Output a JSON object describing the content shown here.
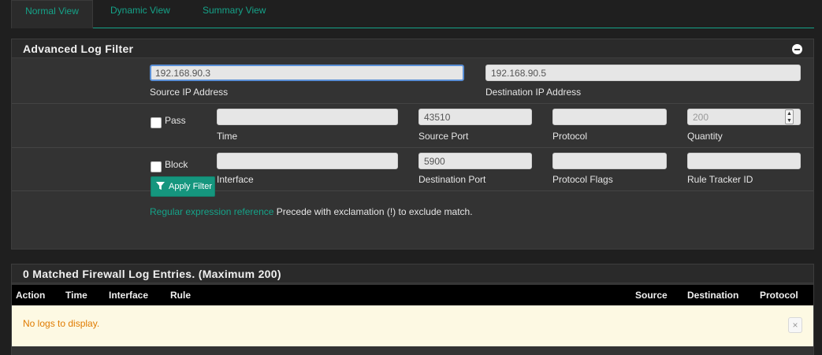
{
  "tabs": [
    {
      "label": "Normal View",
      "active": true
    },
    {
      "label": "Dynamic View",
      "active": false
    },
    {
      "label": "Summary View",
      "active": false
    }
  ],
  "filter_panel": {
    "title": "Advanced Log Filter",
    "source_ip": {
      "value": "192.168.90.3",
      "label": "Source IP Address"
    },
    "destination_ip": {
      "value": "192.168.90.5",
      "label": "Destination IP Address"
    },
    "pass_label": "Pass",
    "block_label": "Block",
    "time": {
      "value": "",
      "label": "Time"
    },
    "source_port": {
      "value": "43510",
      "label": "Source Port"
    },
    "protocol": {
      "value": "",
      "label": "Protocol"
    },
    "quantity": {
      "value": "200",
      "label": "Quantity"
    },
    "interface": {
      "value": "",
      "label": "Interface"
    },
    "destination_port": {
      "value": "5900",
      "label": "Destination Port"
    },
    "protocol_flags": {
      "value": "",
      "label": "Protocol Flags"
    },
    "rule_tracker_id": {
      "value": "",
      "label": "Rule Tracker ID"
    },
    "apply_label": "Apply Filter",
    "help_link": "Regular expression reference",
    "help_text": " Precede with exclamation (!) to exclude match."
  },
  "log_panel": {
    "title": "0 Matched Firewall Log Entries. (Maximum 200)",
    "columns": [
      "Action",
      "Time",
      "Interface",
      "Rule",
      "Source",
      "Destination",
      "Protocol"
    ],
    "empty_message": "No logs to display.",
    "close_glyph": "×"
  },
  "colors": {
    "accent": "#15a389",
    "button": "#15967e",
    "warning_text": "#e07b00",
    "warning_bg": "#fdf9e3"
  }
}
